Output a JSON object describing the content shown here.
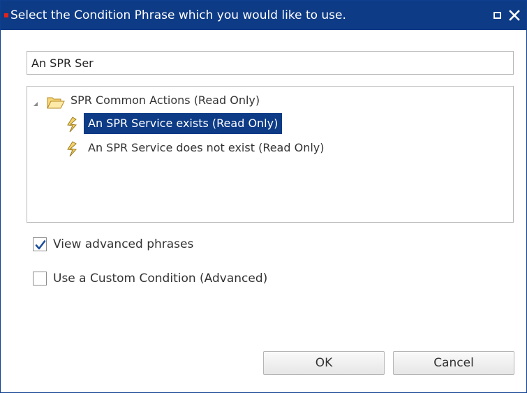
{
  "dialog": {
    "title": "Select the Condition Phrase which you would like to use.",
    "title_buttons": [
      "maximize-icon",
      "close-icon"
    ]
  },
  "search": {
    "value": "An SPR Ser"
  },
  "tree": {
    "root": {
      "label": "SPR Common Actions (Read Only)",
      "icon": "open-folder-icon",
      "expanded": true
    },
    "items": [
      {
        "label": "An SPR Service exists (Read Only)",
        "icon": "condition-phrase-icon",
        "selected": true
      },
      {
        "label": "An SPR Service does not exist (Read Only)",
        "icon": "condition-phrase-icon",
        "selected": false
      }
    ]
  },
  "options": {
    "advanced_phrases": {
      "label": "View advanced phrases",
      "checked": true
    },
    "custom_condition": {
      "label": "Use a Custom Condition (Advanced)",
      "checked": false
    }
  },
  "buttons": {
    "ok": "OK",
    "cancel": "Cancel"
  },
  "colors": {
    "titlebar": "#0d3b86",
    "selection": "#0d3b86",
    "checkmark": "#1b4f9c",
    "title_marker": "#e2231a"
  }
}
